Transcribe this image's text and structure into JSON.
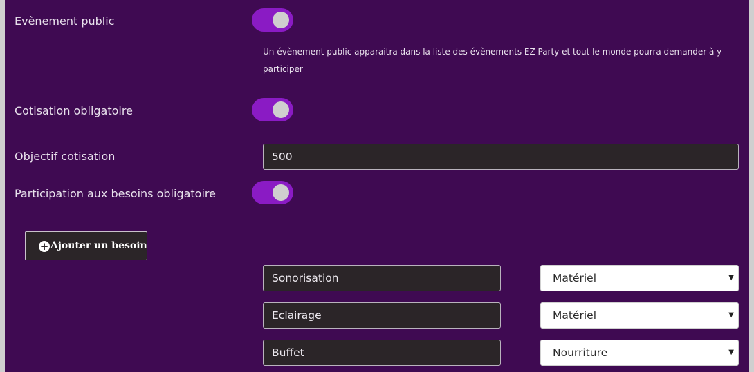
{
  "fields": {
    "public_event": {
      "label": "Evènement public",
      "enabled": true,
      "help": "Un évènement public apparaitra dans la liste des évènements EZ Party et tout le monde pourra demander à y participer"
    },
    "mandatory_contribution": {
      "label": "Cotisation obligatoire",
      "enabled": true
    },
    "contribution_goal": {
      "label": "Objectif cotisation",
      "value": "500"
    },
    "mandatory_needs": {
      "label": "Participation aux besoins obligatoire",
      "enabled": true
    }
  },
  "add_need_button": {
    "label": "Ajouter un besoin",
    "icon": "plus-circle-icon"
  },
  "needs": [
    {
      "name": "Sonorisation",
      "category": "Matériel"
    },
    {
      "name": "Eclairage",
      "category": "Matériel"
    },
    {
      "name": "Buffet",
      "category": "Nourriture"
    }
  ],
  "colors": {
    "panel_background": "#3f0a52",
    "toggle_on": "#8a1bc4",
    "input_background": "#2b2528",
    "outer_background": "#cfcfcf"
  }
}
